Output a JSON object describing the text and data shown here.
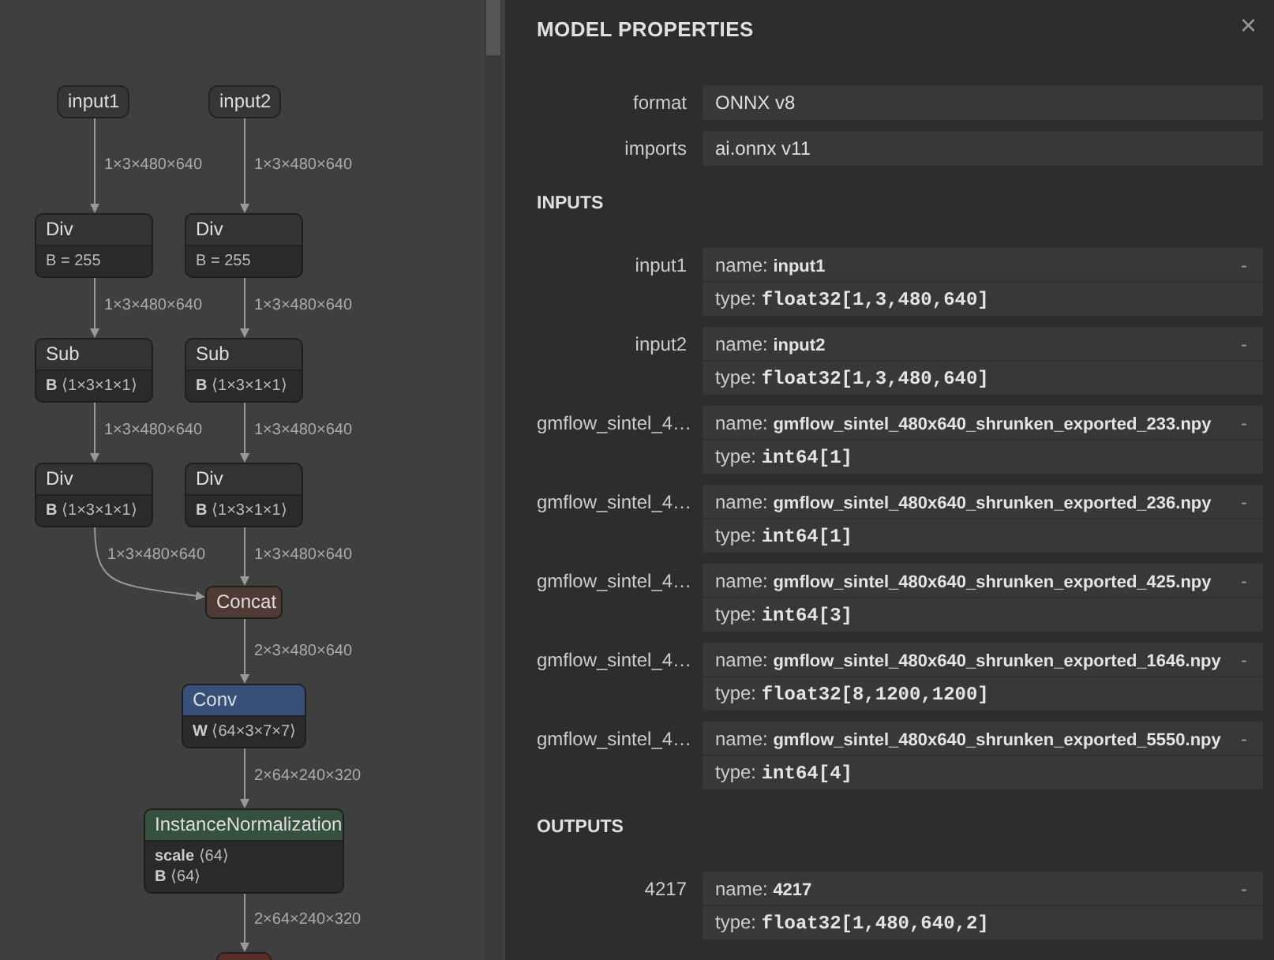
{
  "graph": {
    "nodes": [
      {
        "kind": "input",
        "title": "input1"
      },
      {
        "kind": "input",
        "title": "input2"
      },
      {
        "kind": "op",
        "title": "Div",
        "attributes": [
          {
            "kind": "equals",
            "text": "B = 255"
          }
        ]
      },
      {
        "kind": "op",
        "title": "Div",
        "attributes": [
          {
            "kind": "equals",
            "text": "B = 255"
          }
        ]
      },
      {
        "kind": "op",
        "title": "Sub",
        "attributes": [
          {
            "kind": "tensor",
            "name": "B",
            "shape": "⟨1×3×1×1⟩"
          }
        ]
      },
      {
        "kind": "op",
        "title": "Sub",
        "attributes": [
          {
            "kind": "tensor",
            "name": "B",
            "shape": "⟨1×3×1×1⟩"
          }
        ]
      },
      {
        "kind": "op",
        "title": "Div",
        "attributes": [
          {
            "kind": "tensor",
            "name": "B",
            "shape": "⟨1×3×1×1⟩"
          }
        ]
      },
      {
        "kind": "op",
        "title": "Div",
        "attributes": [
          {
            "kind": "tensor",
            "name": "B",
            "shape": "⟨1×3×1×1⟩"
          }
        ]
      },
      {
        "kind": "op",
        "title": "Concat",
        "color": "#4f3b33"
      },
      {
        "kind": "op",
        "title": "Conv",
        "color": "#36507a",
        "attributes": [
          {
            "kind": "tensor",
            "name": "W",
            "shape": "⟨64×3×7×7⟩"
          }
        ]
      },
      {
        "kind": "op",
        "title": "InstanceNormalization",
        "color": "#36503e",
        "attributes": [
          {
            "kind": "tensor",
            "name": "scale",
            "shape": "⟨64⟩"
          },
          {
            "kind": "tensor",
            "name": "B",
            "shape": "⟨64⟩"
          }
        ]
      },
      {
        "kind": "op",
        "color": "#5a2c2a"
      }
    ],
    "edges": [
      {
        "label": "1×3×480×640"
      },
      {
        "label": "1×3×480×640"
      },
      {
        "label": "1×3×480×640"
      },
      {
        "label": "1×3×480×640"
      },
      {
        "label": "1×3×480×640"
      },
      {
        "label": "1×3×480×640"
      },
      {
        "label": "1×3×480×640"
      },
      {
        "label": "1×3×480×640"
      },
      {
        "label": "2×3×480×640"
      },
      {
        "label": "2×64×240×320"
      },
      {
        "label": "2×64×240×320"
      }
    ]
  },
  "panel": {
    "title": "MODEL PROPERTIES",
    "close": "×",
    "properties": [
      {
        "label": "format",
        "value": "ONNX v8"
      },
      {
        "label": "imports",
        "value": "ai.onnx v11"
      }
    ],
    "sections": [
      {
        "title": "INPUTS",
        "items": [
          {
            "label": "input1",
            "toggle": "-",
            "fields": [
              {
                "kind": "name",
                "key": "name:",
                "value": "input1"
              },
              {
                "kind": "type",
                "key": "type:",
                "value": "float32[1,3,480,640]"
              }
            ]
          },
          {
            "label": "input2",
            "toggle": "-",
            "fields": [
              {
                "kind": "name",
                "key": "name:",
                "value": "input2"
              },
              {
                "kind": "type",
                "key": "type:",
                "value": "float32[1,3,480,640]"
              }
            ]
          },
          {
            "label": "gmflow_sintel_4…",
            "toggle": "-",
            "fields": [
              {
                "kind": "name",
                "key": "name:",
                "value": "gmflow_sintel_480x640_shrunken_exported_233.npy"
              },
              {
                "kind": "type",
                "key": "type:",
                "value": "int64[1]"
              }
            ]
          },
          {
            "label": "gmflow_sintel_4…",
            "toggle": "-",
            "fields": [
              {
                "kind": "name",
                "key": "name:",
                "value": "gmflow_sintel_480x640_shrunken_exported_236.npy"
              },
              {
                "kind": "type",
                "key": "type:",
                "value": "int64[1]"
              }
            ]
          },
          {
            "label": "gmflow_sintel_4…",
            "toggle": "-",
            "fields": [
              {
                "kind": "name",
                "key": "name:",
                "value": "gmflow_sintel_480x640_shrunken_exported_425.npy"
              },
              {
                "kind": "type",
                "key": "type:",
                "value": "int64[3]"
              }
            ]
          },
          {
            "label": "gmflow_sintel_4…",
            "toggle": "-",
            "fields": [
              {
                "kind": "name",
                "key": "name:",
                "value": "gmflow_sintel_480x640_shrunken_exported_1646.npy"
              },
              {
                "kind": "type",
                "key": "type:",
                "value": "float32[8,1200,1200]"
              }
            ]
          },
          {
            "label": "gmflow_sintel_4…",
            "toggle": "-",
            "fields": [
              {
                "kind": "name",
                "key": "name:",
                "value": "gmflow_sintel_480x640_shrunken_exported_5550.npy"
              },
              {
                "kind": "type",
                "key": "type:",
                "value": "int64[4]"
              }
            ]
          }
        ]
      },
      {
        "title": "OUTPUTS",
        "items": [
          {
            "label": "4217",
            "toggle": "-",
            "fields": [
              {
                "kind": "name",
                "key": "name:",
                "value": "4217"
              },
              {
                "kind": "type",
                "key": "type:",
                "value": "float32[1,480,640,2]"
              }
            ]
          }
        ]
      }
    ]
  }
}
